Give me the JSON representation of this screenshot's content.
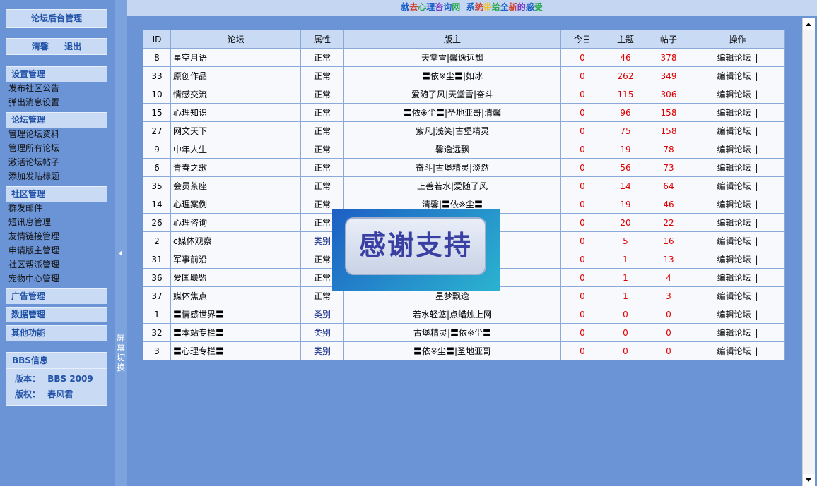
{
  "sidebar": {
    "title": "论坛后台管理",
    "clear_label": "清馨",
    "logout_label": "退出",
    "groups": [
      {
        "title": "设置管理",
        "items": [
          "发布社区公告",
          "弹出消息设置"
        ]
      },
      {
        "title": "论坛管理",
        "items": [
          "管理论坛资料",
          "管理所有论坛",
          "激活论坛帖子",
          "添加发贴标题"
        ]
      },
      {
        "title": "社区管理",
        "items": [
          "群发邮件",
          "短讯息管理",
          "友情链接管理",
          "申请版主管理",
          "社区帮派管理",
          "宠物中心管理"
        ]
      },
      {
        "title": "广告管理",
        "items": []
      },
      {
        "title": "数据管理",
        "items": []
      },
      {
        "title": "其他功能",
        "items": []
      }
    ],
    "bbs_info": {
      "title": "BBS信息",
      "version_label": "版本：",
      "version": "BBS 2009",
      "copyright_label": "版权：",
      "copyright": "春风君"
    }
  },
  "splitter": {
    "label": "屏幕切换"
  },
  "topbar": {
    "slogan_segments": [
      {
        "text": "就",
        "color": "#1a5fc8"
      },
      {
        "text": "去",
        "color": "#d23c2c"
      },
      {
        "text": "心",
        "color": "#27a84a"
      },
      {
        "text": "理",
        "color": "#1a5fc8"
      },
      {
        "text": "咨",
        "color": "#7a3cc8"
      },
      {
        "text": "询",
        "color": "#1a5fc8"
      },
      {
        "text": "网",
        "color": "#27a84a"
      },
      {
        "text": "  系",
        "color": "#1a5fc8"
      },
      {
        "text": "统",
        "color": "#d23c2c"
      },
      {
        "text": "带",
        "color": "#f0c020"
      },
      {
        "text": "给",
        "color": "#27a84a"
      },
      {
        "text": "全",
        "color": "#1a5fc8"
      },
      {
        "text": "新",
        "color": "#d23c2c"
      },
      {
        "text": "的",
        "color": "#7a3cc8"
      },
      {
        "text": "感",
        "color": "#1a5fc8"
      },
      {
        "text": "受",
        "color": "#27a84a"
      }
    ]
  },
  "table": {
    "headers": [
      "ID",
      "论坛",
      "属性",
      "版主",
      "今日",
      "主题",
      "帖子",
      "操作"
    ],
    "op_label": "编辑论坛",
    "op_sep": "|",
    "rows": [
      {
        "id": "8",
        "name": "星空月语",
        "attr": "正常",
        "mods": "天堂雪|馨逸远飘",
        "today": "0",
        "topics": "46",
        "posts": "378"
      },
      {
        "id": "33",
        "name": "原创作品",
        "attr": "正常",
        "mods": "〓依※尘〓|如冰",
        "today": "0",
        "topics": "262",
        "posts": "349"
      },
      {
        "id": "10",
        "name": "情感交流",
        "attr": "正常",
        "mods": "爱随了风|天堂雪|奋斗",
        "today": "0",
        "topics": "115",
        "posts": "306"
      },
      {
        "id": "15",
        "name": "心理知识",
        "attr": "正常",
        "mods": "〓依※尘〓|圣地亚哥|清馨",
        "today": "0",
        "topics": "96",
        "posts": "158"
      },
      {
        "id": "27",
        "name": "网文天下",
        "attr": "正常",
        "mods": "紫凡|浅笑|古堡精灵",
        "today": "0",
        "topics": "75",
        "posts": "158"
      },
      {
        "id": "9",
        "name": "中年人生",
        "attr": "正常",
        "mods": "馨逸远飘",
        "today": "0",
        "topics": "19",
        "posts": "78"
      },
      {
        "id": "6",
        "name": "青春之歌",
        "attr": "正常",
        "mods": "奋斗|古堡精灵|淡然",
        "today": "0",
        "topics": "56",
        "posts": "73"
      },
      {
        "id": "35",
        "name": "会员茶座",
        "attr": "正常",
        "mods": "上善若水|爱随了风",
        "today": "0",
        "topics": "14",
        "posts": "64"
      },
      {
        "id": "14",
        "name": "心理案例",
        "attr": "正常",
        "mods": "清馨|〓依※尘〓",
        "today": "0",
        "topics": "19",
        "posts": "46"
      },
      {
        "id": "26",
        "name": "心理咨询",
        "attr": "正常",
        "mods": "",
        "today": "0",
        "topics": "20",
        "posts": "22"
      },
      {
        "id": "2",
        "name": "c媒体观察",
        "attr": "类别",
        "mods": "",
        "today": "0",
        "topics": "5",
        "posts": "16"
      },
      {
        "id": "31",
        "name": "军事前沿",
        "attr": "正常",
        "mods": "",
        "today": "0",
        "topics": "1",
        "posts": "13"
      },
      {
        "id": "36",
        "name": "爱国联盟",
        "attr": "正常",
        "mods": "",
        "today": "0",
        "topics": "1",
        "posts": "4"
      },
      {
        "id": "37",
        "name": "媒体焦点",
        "attr": "正常",
        "mods": "星梦飘逸",
        "today": "0",
        "topics": "1",
        "posts": "3"
      },
      {
        "id": "1",
        "name": "〓情感世界〓",
        "attr": "类别",
        "mods": "若水轻悠|点蜡烛上网",
        "today": "0",
        "topics": "0",
        "posts": "0"
      },
      {
        "id": "32",
        "name": "〓本站专栏〓",
        "attr": "类别",
        "mods": "古堡精灵|〓依※尘〓",
        "today": "0",
        "topics": "0",
        "posts": "0"
      },
      {
        "id": "3",
        "name": "〓心理专栏〓",
        "attr": "类别",
        "mods": "〓依※尘〓|圣地亚哥",
        "today": "0",
        "topics": "0",
        "posts": "0"
      }
    ]
  },
  "overlay": {
    "text": "感谢支持"
  }
}
